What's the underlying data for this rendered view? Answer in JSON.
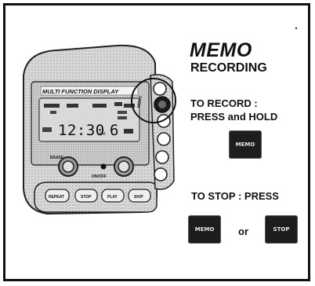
{
  "title": "MEMO",
  "subtitle": "RECORDING",
  "record_instruction": {
    "line1": "TO RECORD :",
    "line2": "PRESS and HOLD"
  },
  "stop_instruction": "TO STOP : PRESS",
  "or_label": "or",
  "buttons": {
    "memo": "MEMO",
    "stop": "STOP"
  },
  "device": {
    "display_title": "MULTI FUNCTION DISPLAY",
    "time": "12:30",
    "time_suffix": "PM",
    "number": "6",
    "labels": {
      "erase": "ERASE",
      "memo": "MEMO",
      "onoff": "ON/OFF"
    },
    "bottom_buttons": [
      "REPEAT",
      "STOP",
      "PLAY",
      "SKIP"
    ]
  }
}
